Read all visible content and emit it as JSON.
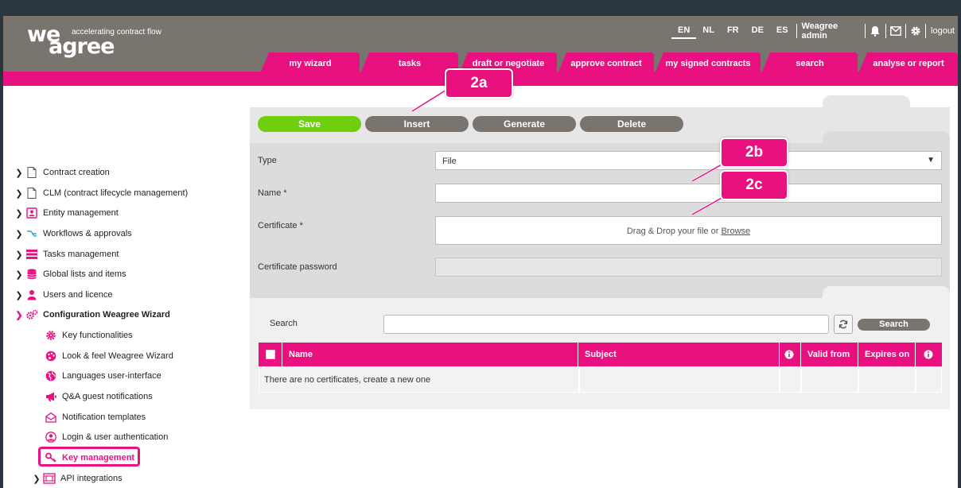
{
  "header": {
    "logo_top": "we",
    "logo_bottom": "agree",
    "tagline": "accelerating contract flow",
    "languages": [
      "EN",
      "NL",
      "FR",
      "DE",
      "ES"
    ],
    "active_language": "EN",
    "user": "Weagree admin",
    "logout": "logout"
  },
  "nav_tabs": [
    "my wizard",
    "tasks",
    "draft or negotiate",
    "approve contract",
    "my signed contracts",
    "search",
    "analyse or report"
  ],
  "toolbar": {
    "save": "Save",
    "insert": "Insert",
    "generate": "Generate",
    "delete": "Delete"
  },
  "form": {
    "type_label": "Type",
    "type_value": "File",
    "name_label": "Name *",
    "certificate_label": "Certificate *",
    "drop_text": "Drag & Drop your file or",
    "browse": "Browse",
    "password_label": "Certificate password"
  },
  "search": {
    "label": "Search",
    "button": "Search"
  },
  "table": {
    "headers": [
      "Name",
      "Subject",
      "Valid from",
      "Expires on"
    ],
    "empty_message": "There are no certificates, create a new one"
  },
  "sidebar": [
    "Contract creation",
    "CLM (contract lifecycle management)",
    "Entity management",
    "Workflows & approvals",
    "Tasks management",
    "Global lists and items",
    "Users and licence",
    "Configuration Weagree Wizard",
    "Key functionalities",
    "Look & feel Weagree Wizard",
    "Languages user-interface",
    "Q&A guest notifications",
    "Notification templates",
    "Login & user authentication",
    "Key management",
    "API integrations"
  ],
  "callouts": [
    "2a",
    "2b",
    "2c"
  ],
  "colors": {
    "brand": "#e8117f",
    "header": "#7a746e",
    "save": "#6fcf0c"
  }
}
